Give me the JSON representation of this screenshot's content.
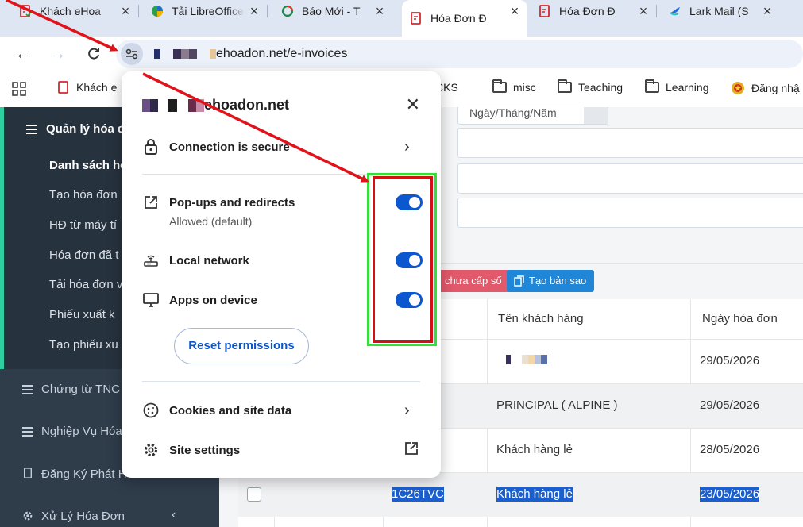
{
  "tabs": [
    {
      "title": "Khách eHoa",
      "active": false,
      "favicon": "invoice-icon"
    },
    {
      "title": "Tải LibreOffice",
      "active": false,
      "favicon": "libreoffice-icon"
    },
    {
      "title": "Báo Mới - T",
      "active": false,
      "favicon": "baomoi-icon"
    },
    {
      "title": "Hóa Đơn Đ",
      "active": true,
      "favicon": "invoice-icon"
    },
    {
      "title": "Hóa Đơn Đ",
      "active": false,
      "favicon": "invoice-icon"
    },
    {
      "title": "Lark Mail (S",
      "active": false,
      "favicon": "lark-icon"
    }
  ],
  "address_bar": {
    "url_suffix": "ehoadon.net/e-invoices"
  },
  "bookmarks": {
    "first": "Khách e",
    "folders": [
      "CKS",
      "misc",
      "Teaching",
      "Learning"
    ],
    "last": "Đăng nhậ"
  },
  "sidebar": {
    "section": "Quản lý hóa đ",
    "items": [
      "Danh sách hó",
      "Tạo hóa đơn",
      "HĐ từ máy tí",
      "Hóa đơn đã t",
      "Tải hóa đơn v",
      "Phiếu xuất k",
      "Tạo phiếu xu"
    ],
    "groups": [
      "Chứng từ TNC",
      "Nghiệp Vụ Hóa",
      "Đăng Ký Phát H",
      "Xử Lý Hóa Đơn"
    ]
  },
  "main": {
    "date_placeholder": "Ngày/Tháng/Năm",
    "buttons": {
      "issue_number": "chưa cấp số",
      "copy": "Tạo bản sao"
    },
    "columns": {
      "customer": "Tên khách hàng",
      "invoice_date": "Ngày hóa đơn"
    },
    "rows": [
      {
        "symbol": "",
        "customer": "",
        "date": "29/05/2026",
        "selected": false
      },
      {
        "symbol": "",
        "customer": "PRINCIPAL ( ALPINE )",
        "date": "29/05/2026",
        "selected": false
      },
      {
        "symbol": "",
        "customer": "Khách hàng lẻ",
        "date": "28/05/2026",
        "selected": false
      },
      {
        "symbol": "1C26TVC",
        "customer": "Khách hàng lẻ",
        "date": "23/05/2026",
        "selected": true
      }
    ]
  },
  "popup": {
    "domain": "ehoadon.net",
    "connection": "Connection is secure",
    "permissions": [
      {
        "label": "Pop-ups and redirects",
        "sub": "Allowed (default)",
        "icon": "external-open-icon",
        "enabled": true
      },
      {
        "label": "Local network",
        "sub": "",
        "icon": "router-icon",
        "enabled": true
      },
      {
        "label": "Apps on device",
        "sub": "",
        "icon": "monitor-icon",
        "enabled": true
      }
    ],
    "reset_label": "Reset permissions",
    "cookies": "Cookies and site data",
    "site_settings": "Site settings"
  },
  "colors": {
    "accent": "#0b57d0",
    "annotation_red": "#e0121a",
    "annotation_green": "#33e03a"
  }
}
